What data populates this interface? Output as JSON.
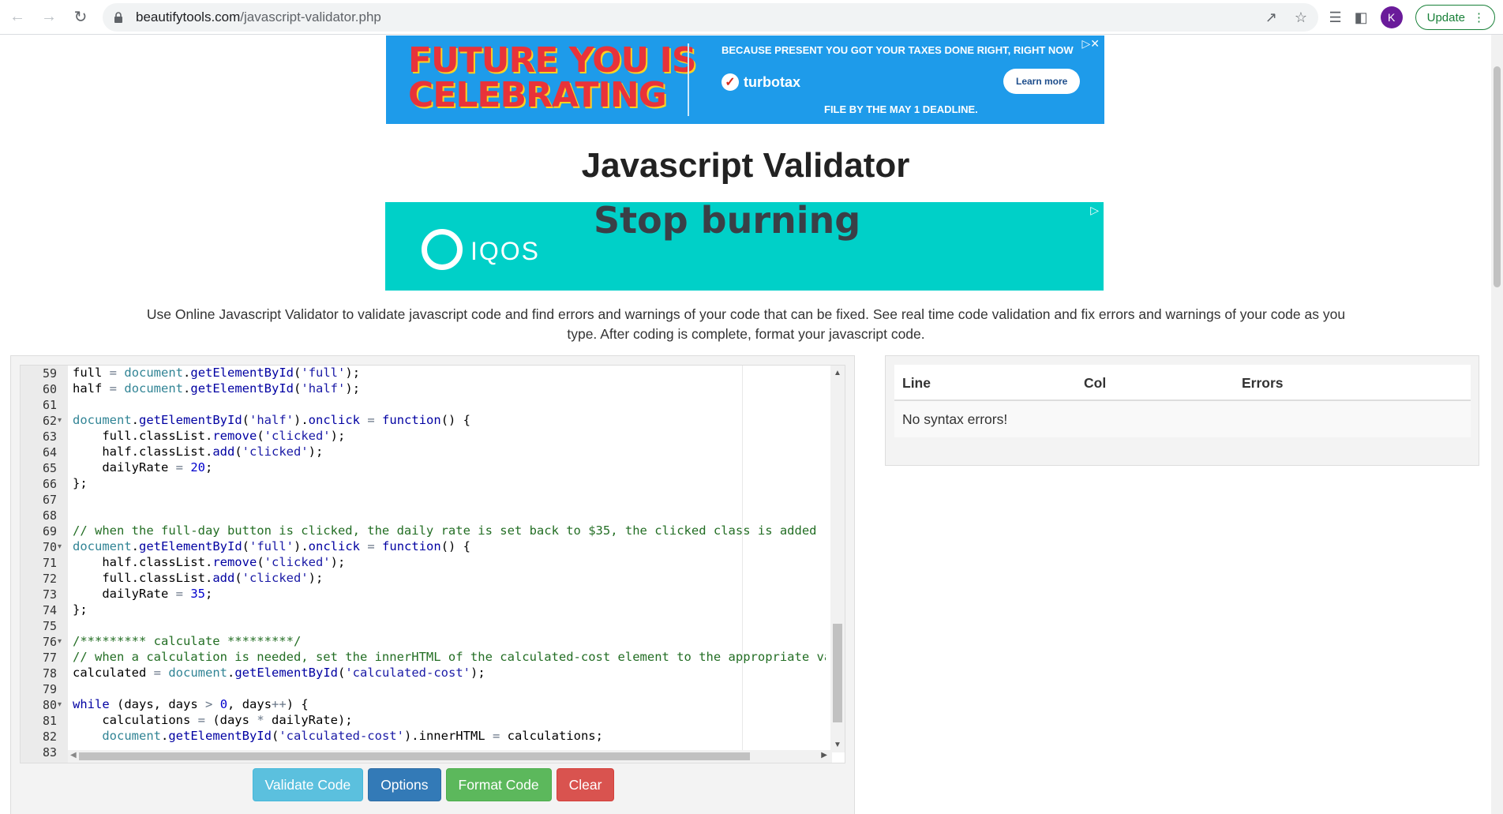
{
  "browser": {
    "url_host": "beautifytools.com",
    "url_path": "/javascript-validator.php",
    "avatar_letter": "K",
    "update_label": "Update"
  },
  "ad_top": {
    "headline_line1": "FUTURE YOU IS",
    "headline_line2": "CELEBRATING",
    "tagline": "BECAUSE PRESENT YOU GOT YOUR TAXES DONE RIGHT, RIGHT NOW",
    "brand": "turbotax",
    "cta": "Learn more",
    "subline": "FILE BY THE MAY 1 DEADLINE."
  },
  "ad_mid": {
    "headline": "Stop burning",
    "brand": "IQOS"
  },
  "page": {
    "title": "Javascript Validator",
    "description": "Use Online Javascript Validator to validate javascript code and find errors and warnings of your code that can be fixed. See real time code validation and fix errors and warnings of your code as you type. After coding is complete, format your javascript code."
  },
  "editor": {
    "lines": [
      {
        "n": "59",
        "fold": false
      },
      {
        "n": "60",
        "fold": false
      },
      {
        "n": "61",
        "fold": false
      },
      {
        "n": "62",
        "fold": true
      },
      {
        "n": "63",
        "fold": false
      },
      {
        "n": "64",
        "fold": false
      },
      {
        "n": "65",
        "fold": false
      },
      {
        "n": "66",
        "fold": false
      },
      {
        "n": "67",
        "fold": false
      },
      {
        "n": "68",
        "fold": false
      },
      {
        "n": "69",
        "fold": false
      },
      {
        "n": "70",
        "fold": true
      },
      {
        "n": "71",
        "fold": false
      },
      {
        "n": "72",
        "fold": false
      },
      {
        "n": "73",
        "fold": false
      },
      {
        "n": "74",
        "fold": false
      },
      {
        "n": "75",
        "fold": false
      },
      {
        "n": "76",
        "fold": true
      },
      {
        "n": "77",
        "fold": false
      },
      {
        "n": "78",
        "fold": false
      },
      {
        "n": "79",
        "fold": false
      },
      {
        "n": "80",
        "fold": true
      },
      {
        "n": "81",
        "fold": false
      },
      {
        "n": "82",
        "fold": false
      },
      {
        "n": "83",
        "fold": false
      }
    ],
    "code": [
      [
        [
          "",
          "full "
        ],
        [
          "op",
          "="
        ],
        [
          "",
          " "
        ],
        [
          "obj",
          "document"
        ],
        [
          "",
          "."
        ],
        [
          "fn",
          "getElementById"
        ],
        [
          "",
          "("
        ],
        [
          "str",
          "'full'"
        ],
        [
          "",
          ");"
        ]
      ],
      [
        [
          "",
          "half "
        ],
        [
          "op",
          "="
        ],
        [
          "",
          " "
        ],
        [
          "obj",
          "document"
        ],
        [
          "",
          "."
        ],
        [
          "fn",
          "getElementById"
        ],
        [
          "",
          "("
        ],
        [
          "str",
          "'half'"
        ],
        [
          "",
          ");"
        ]
      ],
      [],
      [
        [
          "obj",
          "document"
        ],
        [
          "",
          "."
        ],
        [
          "fn",
          "getElementById"
        ],
        [
          "",
          "("
        ],
        [
          "str",
          "'half'"
        ],
        [
          "",
          ")."
        ],
        [
          "fn",
          "onclick"
        ],
        [
          "",
          " "
        ],
        [
          "op",
          "="
        ],
        [
          "",
          " "
        ],
        [
          "kw",
          "function"
        ],
        [
          "",
          "() {"
        ]
      ],
      [
        [
          "",
          "    full.classList."
        ],
        [
          "fn",
          "remove"
        ],
        [
          "",
          "("
        ],
        [
          "str",
          "'clicked'"
        ],
        [
          "",
          ");"
        ]
      ],
      [
        [
          "",
          "    half.classList."
        ],
        [
          "fn",
          "add"
        ],
        [
          "",
          "("
        ],
        [
          "str",
          "'clicked'"
        ],
        [
          "",
          ");"
        ]
      ],
      [
        [
          "",
          "    dailyRate "
        ],
        [
          "op",
          "="
        ],
        [
          "",
          " "
        ],
        [
          "num",
          "20"
        ],
        [
          "",
          ";"
        ]
      ],
      [
        [
          "",
          "};"
        ]
      ],
      [],
      [],
      [
        [
          "com",
          "// when the full-day button is clicked, the daily rate is set back to $35, the clicked class is added"
        ]
      ],
      [
        [
          "obj",
          "document"
        ],
        [
          "",
          "."
        ],
        [
          "fn",
          "getElementById"
        ],
        [
          "",
          "("
        ],
        [
          "str",
          "'full'"
        ],
        [
          "",
          ")."
        ],
        [
          "fn",
          "onclick"
        ],
        [
          "",
          " "
        ],
        [
          "op",
          "="
        ],
        [
          "",
          " "
        ],
        [
          "kw",
          "function"
        ],
        [
          "",
          "() {"
        ]
      ],
      [
        [
          "",
          "    half.classList."
        ],
        [
          "fn",
          "remove"
        ],
        [
          "",
          "("
        ],
        [
          "str",
          "'clicked'"
        ],
        [
          "",
          ");"
        ]
      ],
      [
        [
          "",
          "    full.classList."
        ],
        [
          "fn",
          "add"
        ],
        [
          "",
          "("
        ],
        [
          "str",
          "'clicked'"
        ],
        [
          "",
          ");"
        ]
      ],
      [
        [
          "",
          "    dailyRate "
        ],
        [
          "op",
          "="
        ],
        [
          "",
          " "
        ],
        [
          "num",
          "35"
        ],
        [
          "",
          ";"
        ]
      ],
      [
        [
          "",
          "};"
        ]
      ],
      [],
      [
        [
          "com",
          "/********* calculate *********/"
        ]
      ],
      [
        [
          "com",
          "// when a calculation is needed, set the innerHTML of the calculated-cost element to the appropriate value"
        ]
      ],
      [
        [
          "",
          "calculated "
        ],
        [
          "op",
          "="
        ],
        [
          "",
          " "
        ],
        [
          "obj",
          "document"
        ],
        [
          "",
          "."
        ],
        [
          "fn",
          "getElementById"
        ],
        [
          "",
          "("
        ],
        [
          "str",
          "'calculated-cost'"
        ],
        [
          "",
          ");"
        ]
      ],
      [],
      [
        [
          "kw",
          "while"
        ],
        [
          "",
          " (days, days "
        ],
        [
          "op",
          ">"
        ],
        [
          "",
          " "
        ],
        [
          "num",
          "0"
        ],
        [
          "",
          ", days"
        ],
        [
          "op",
          "++"
        ],
        [
          "",
          ") {"
        ]
      ],
      [
        [
          "",
          "    calculations "
        ],
        [
          "op",
          "="
        ],
        [
          "",
          " (days "
        ],
        [
          "op",
          "*"
        ],
        [
          "",
          " dailyRate);"
        ]
      ],
      [
        [
          "",
          "    "
        ],
        [
          "obj",
          "document"
        ],
        [
          "",
          "."
        ],
        [
          "fn",
          "getElementById"
        ],
        [
          "",
          "("
        ],
        [
          "str",
          "'calculated-cost'"
        ],
        [
          "",
          ").innerHTML "
        ],
        [
          "op",
          "="
        ],
        [
          "",
          " calculations;"
        ]
      ],
      []
    ]
  },
  "buttons": {
    "validate": "Validate Code",
    "options": "Options",
    "format": "Format Code",
    "clear": "Clear"
  },
  "results": {
    "col_line": "Line",
    "col_col": "Col",
    "col_errors": "Errors",
    "message": "No syntax errors!"
  },
  "colors": {
    "validate": "#5bc0de",
    "options": "#337ab7",
    "format": "#5cb85c",
    "clear": "#d9534f"
  }
}
